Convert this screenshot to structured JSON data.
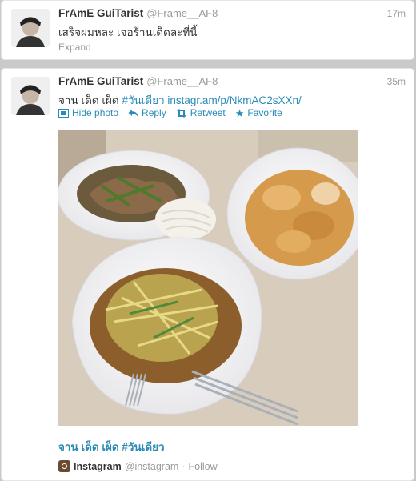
{
  "tweets": [
    {
      "name": "FrAmE GuiTarist",
      "handle": "@Frame__AF8",
      "time": "17m",
      "text": "เสร็จผมหละ เจอร้านเด็ดละที่นี้",
      "expand_label": "Expand"
    },
    {
      "name": "FrAmE GuiTarist",
      "handle": "@Frame__AF8",
      "time": "35m",
      "text_plain": "จาน เด็ด เผ็ด",
      "hashtag": "#วันเดียว",
      "url": "instagr.am/p/NkmAC2sXXn/",
      "actions": {
        "hide_photo": "Hide photo",
        "reply": "Reply",
        "retweet": "Retweet",
        "favorite": "Favorite"
      },
      "caption": "จาน เด็ด เผ็ด #วันเดียว",
      "source": {
        "app": "Instagram",
        "handle": "@instagram",
        "separator": "·",
        "follow": "Follow"
      }
    }
  ],
  "colors": {
    "link": "#2a8ab8",
    "muted": "#999999",
    "text": "#333333"
  }
}
